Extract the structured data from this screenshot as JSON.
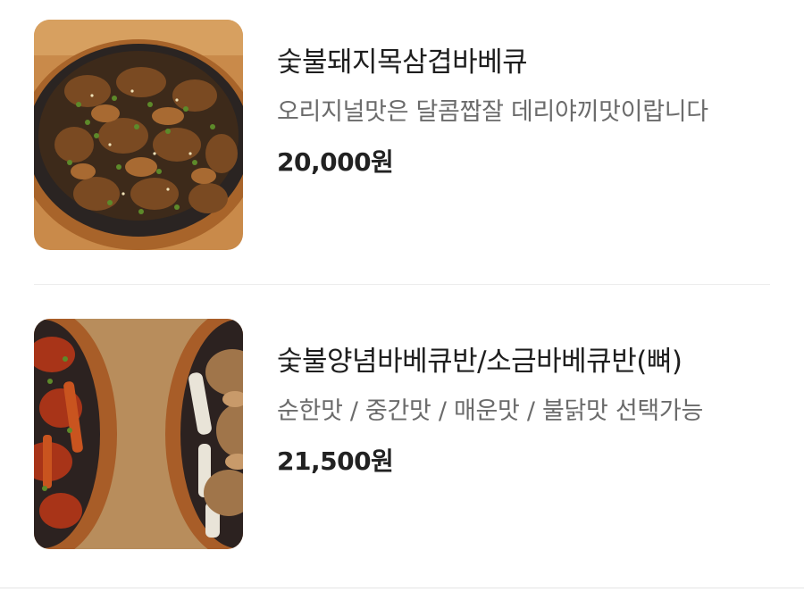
{
  "menu": {
    "items": [
      {
        "name": "숯불돼지목삼겹바베큐",
        "description": "오리지널맛은 달콤짭잘 데리야끼맛이랍니다",
        "price": "20,000원"
      },
      {
        "name": "숯불양념바베큐반/소금바베큐반(뼈)",
        "description": "순한맛 / 중간맛 / 매운맛 / 불닭맛 선택가능",
        "price": "21,500원"
      }
    ]
  },
  "colors": {
    "name": "#1e1e1e",
    "description": "#6b6b6b",
    "price": "#222222",
    "divider": "#ececec"
  }
}
